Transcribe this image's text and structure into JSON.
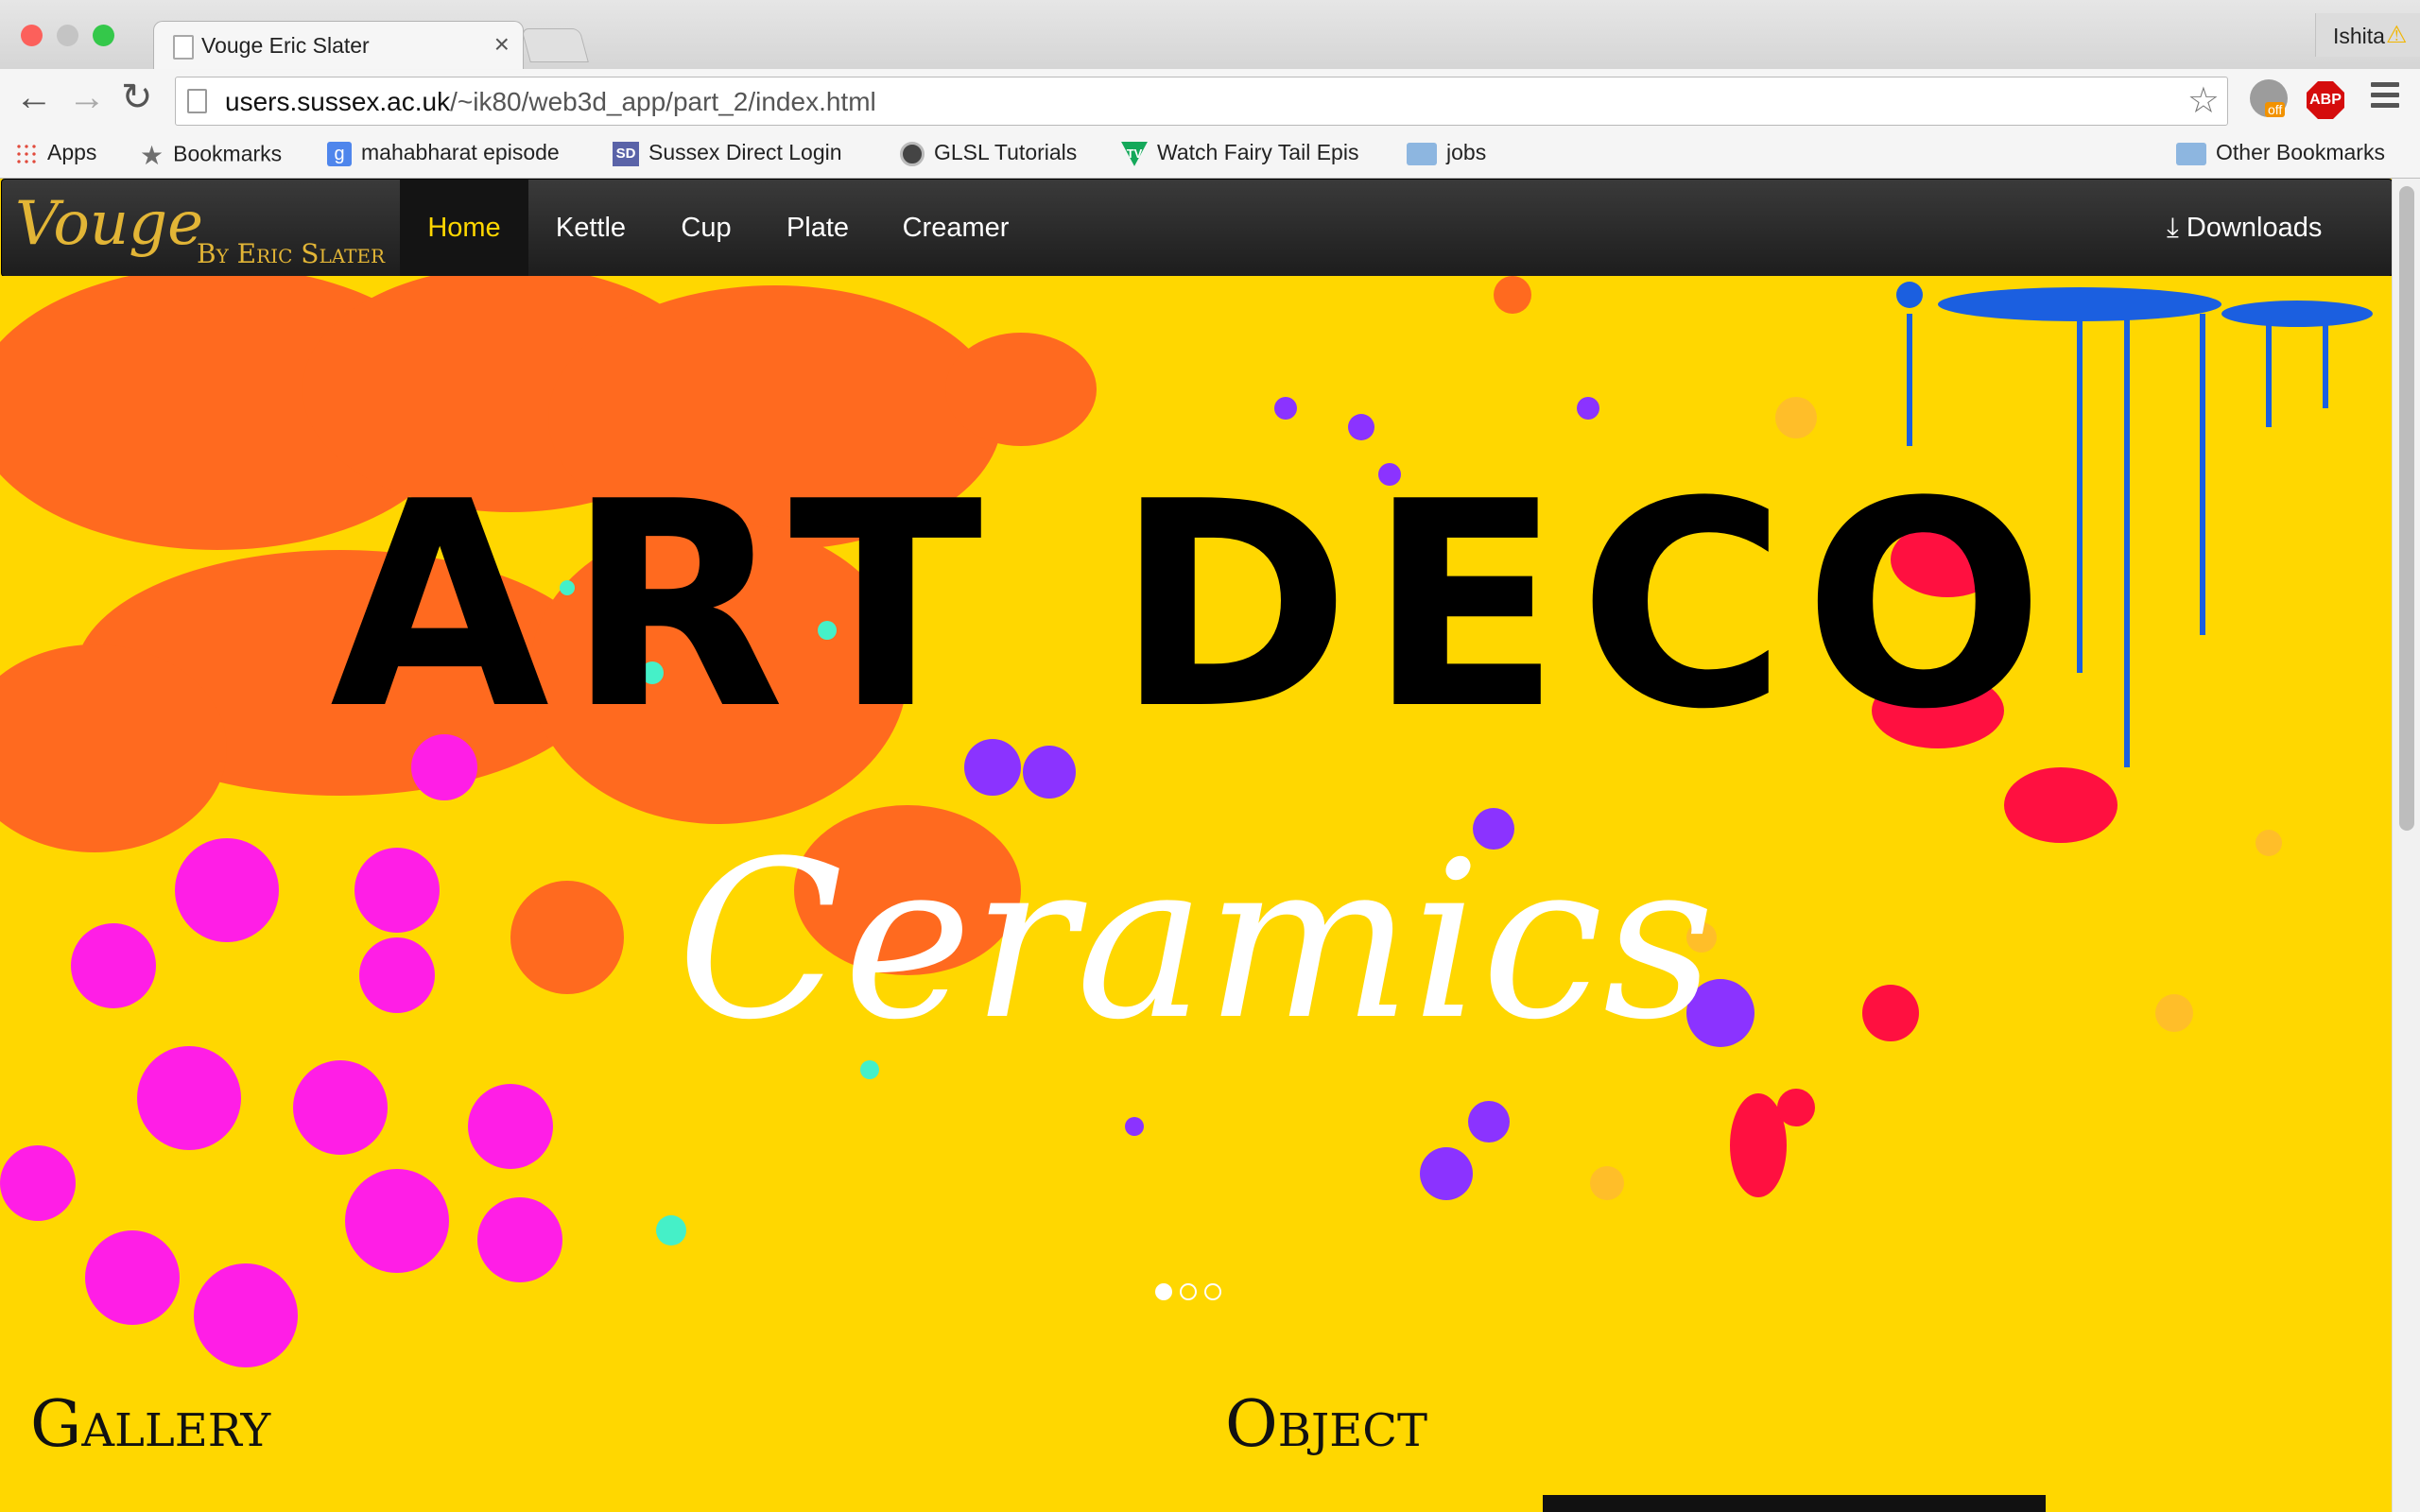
{
  "browser": {
    "tab_title": "Vouge Eric Slater",
    "tab_close": "×",
    "profile": "Ishita",
    "profile_warning": "⚠",
    "back": "←",
    "forward": "→",
    "reload": "↻",
    "url_host": "users.sussex.ac.uk",
    "url_path": "/~ik80/web3d_app/part_2/index.html",
    "star": "☆",
    "ext_badge": "off",
    "abp": "ABP",
    "bookmarks": [
      {
        "label": "Apps",
        "icon": "apps-icon"
      },
      {
        "label": "Bookmarks",
        "icon": "star-icon"
      },
      {
        "label": "mahabharat episode",
        "icon": "google-icon",
        "glyph": "g"
      },
      {
        "label": "Sussex Direct Login",
        "icon": "sussex-direct-icon",
        "glyph": "SD"
      },
      {
        "label": "GLSL Tutorials",
        "icon": "glsl-icon"
      },
      {
        "label": "Watch Fairy Tail Epis",
        "icon": "tv-icon",
        "glyph": "TV"
      },
      {
        "label": "jobs",
        "icon": "folder-icon"
      }
    ],
    "other_bookmarks": "Other Bookmarks"
  },
  "site": {
    "brand_word": "Vouge",
    "brand_by": "By Eric Slater",
    "nav": [
      "Home",
      "Kettle",
      "Cup",
      "Plate",
      "Creamer"
    ],
    "downloads_icon": "⤓",
    "downloads": "Downloads",
    "hero_headline": "ART DECO",
    "hero_sub": "Ceramics",
    "carousel_slides": 3,
    "carousel_active": 1,
    "section_gallery": "Gallery",
    "section_object": "Object"
  },
  "colors": {
    "page_bg": "#ffd700",
    "nav_active": "#ffd700",
    "brand": "#e2b536",
    "splash_orange": "#ff6a1f",
    "splash_magenta": "#ff1ee6",
    "splash_purple": "#8b33ff",
    "splash_blue": "#1b5fe0",
    "splash_red": "#ff1040",
    "splash_mint": "#45f0c8"
  }
}
